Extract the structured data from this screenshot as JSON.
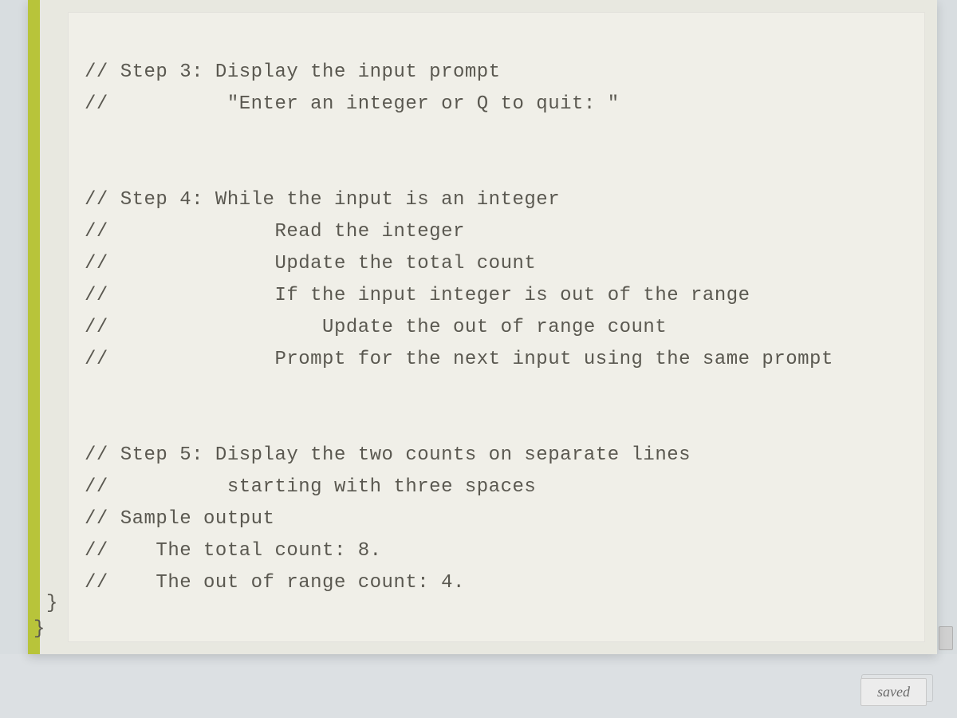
{
  "code": {
    "step3": {
      "header": "// Step 3: Display the input prompt",
      "line1": "//          \"Enter an integer or Q to quit: \""
    },
    "step4": {
      "header": "// Step 4: While the input is an integer",
      "line1": "//              Read the integer",
      "line2": "//              Update the total count",
      "line3": "//              If the input integer is out of the range",
      "line4": "//                  Update the out of range count",
      "line5": "//              Prompt for the next input using the same prompt"
    },
    "step5": {
      "header": "// Step 5: Display the two counts on separate lines",
      "line1": "//          starting with three spaces",
      "sample": "// Sample output",
      "out1": "//    The total count: 8.",
      "out2": "//    The out of range count: 4."
    },
    "brace1": "  }",
    "brace2": "}"
  },
  "status": {
    "saved_label": "saved"
  }
}
